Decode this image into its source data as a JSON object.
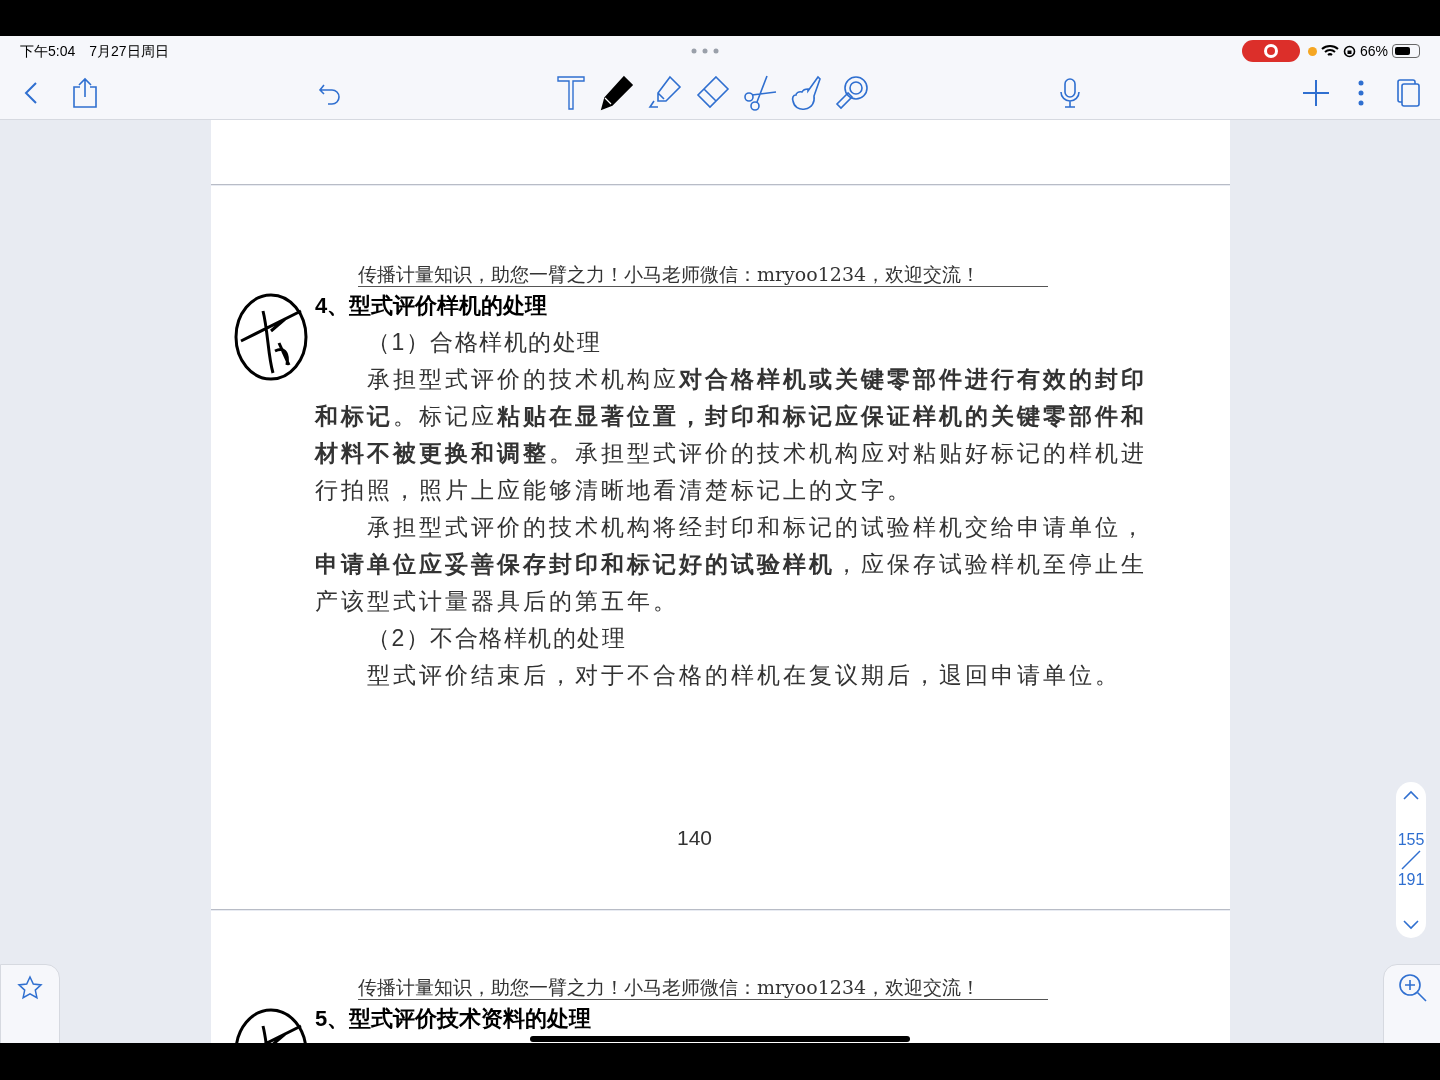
{
  "status_bar": {
    "time": "下午5:04",
    "date": "7月27日周日",
    "battery": "66%"
  },
  "toolbar": {
    "tools": [
      {
        "kind": "text",
        "selected": false
      },
      {
        "kind": "pen",
        "selected": true
      },
      {
        "kind": "highlighter",
        "selected": false
      },
      {
        "kind": "eraser",
        "selected": false
      },
      {
        "kind": "scissors",
        "selected": false
      },
      {
        "kind": "hand",
        "selected": false
      },
      {
        "kind": "laser",
        "selected": false
      }
    ]
  },
  "pages": [
    {
      "header": "传播计量知识，助您一臂之力！小马老师微信：mryoo1234，欢迎交流！",
      "blocks": [
        {
          "kind": "heading",
          "text": "4、型式评价样机的处理"
        },
        {
          "kind": "subheading",
          "text": "（1）合格样机的处理"
        },
        {
          "kind": "body",
          "text": "承担型式评价的技术机构应**对合格样机或关键零部件进行有效的封印和标记**。标记应**粘贴在显著位置，封印和标记应保证样机的关键零部件和材料不被更换和调整**。承担型式评价的技术机构应对粘贴好标记的样机进行拍照，照片上应能够清晰地看清楚标记上的文字。"
        },
        {
          "kind": "body",
          "text": "承担型式评价的技术机构将经封印和标记的试验样机交给申请单位，**申请单位应妥善保存封印和标记好的试验样机**，应保存试验样机至停止生产该型式计量器具后的第五年。"
        },
        {
          "kind": "subheading",
          "text": "（2）不合格样机的处理"
        },
        {
          "kind": "body",
          "text": "型式评价结束后，对于不合格的样机在复议期后，退回申请单位。"
        }
      ],
      "page_number": "140"
    },
    {
      "header": "传播计量知识，助您一臂之力！小马老师微信：mryoo1234，欢迎交流！",
      "blocks": [
        {
          "kind": "heading",
          "text": "5、型式评价技术资料的处理"
        }
      ]
    }
  ],
  "page_navigator": {
    "current": "155",
    "total": "191"
  }
}
